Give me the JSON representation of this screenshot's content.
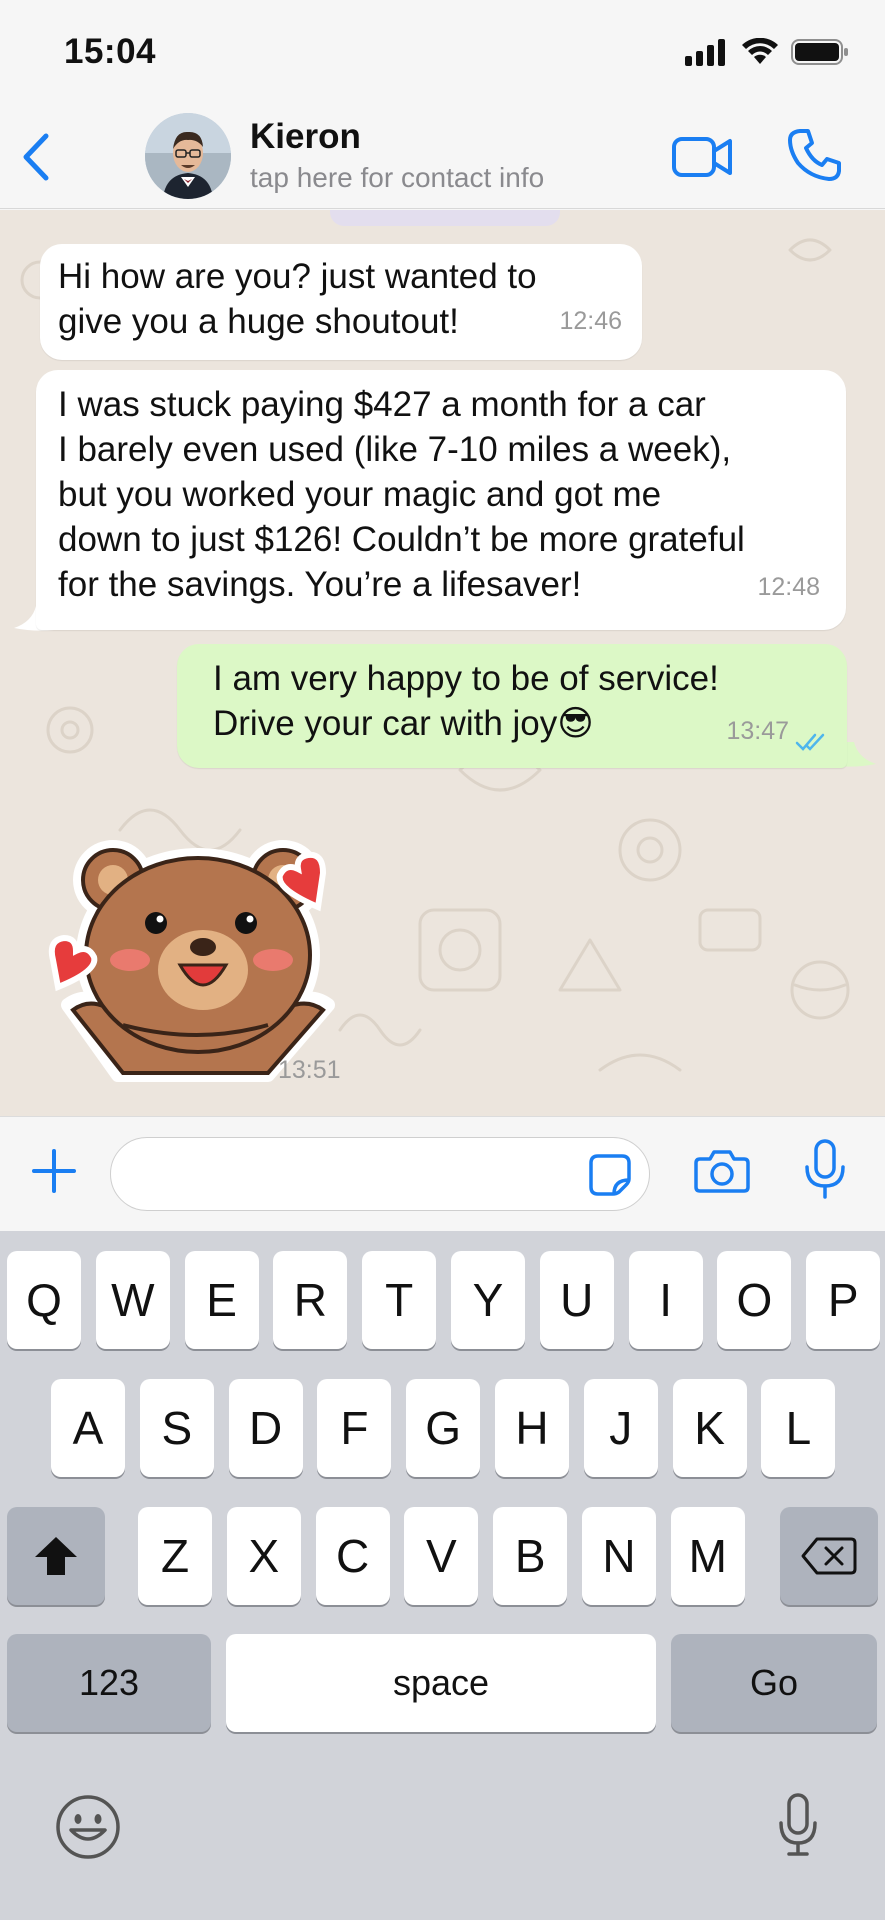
{
  "status_bar": {
    "time": "15:04"
  },
  "header": {
    "back_icon": "chevron-left-icon",
    "contact_name": "Kieron",
    "contact_subtitle": "tap here for contact info",
    "video_icon": "video-camera-icon",
    "call_icon": "phone-icon"
  },
  "messages": [
    {
      "direction": "incoming",
      "text": "Hi how are you? just wanted to\ngive you a huge shoutout!",
      "time": "12:46"
    },
    {
      "direction": "incoming",
      "text": "I was stuck paying $427 a month for a car\nI barely even used (like 7-10 miles a week),\nbut you worked your magic and got me\ndown to just $126! Couldn’t be more grateful\nfor the savings. You’re a lifesaver!",
      "time": "12:48"
    },
    {
      "direction": "outgoing",
      "text": "I am very happy to be of service!\nDrive your car with joy",
      "emoji": "😎",
      "time": "13:47",
      "status": "read"
    },
    {
      "direction": "incoming",
      "type": "sticker",
      "sticker": "bear-with-hearts",
      "time": "13:51"
    }
  ],
  "input_bar": {
    "placeholder": "",
    "plus_icon": "plus-icon",
    "sticker_icon": "sticker-icon",
    "camera_icon": "camera-icon",
    "mic_icon": "microphone-icon"
  },
  "keyboard": {
    "row1": [
      "Q",
      "W",
      "E",
      "R",
      "T",
      "Y",
      "U",
      "I",
      "O",
      "P"
    ],
    "row2": [
      "A",
      "S",
      "D",
      "F",
      "G",
      "H",
      "J",
      "K",
      "L"
    ],
    "row3": [
      "Z",
      "X",
      "C",
      "V",
      "B",
      "N",
      "M"
    ],
    "numbers_label": "123",
    "space_label": "space",
    "go_label": "Go",
    "shift_icon": "shift-icon",
    "backspace_icon": "backspace-icon",
    "emoji_icon": "emoji-icon",
    "dictation_icon": "microphone-icon"
  },
  "colors": {
    "accent": "#1a7ef2",
    "outgoing_bubble": "#dcf8c6",
    "incoming_bubble": "#ffffff",
    "chat_bg": "#ece5dd",
    "read_ticks": "#4fb6ec"
  }
}
